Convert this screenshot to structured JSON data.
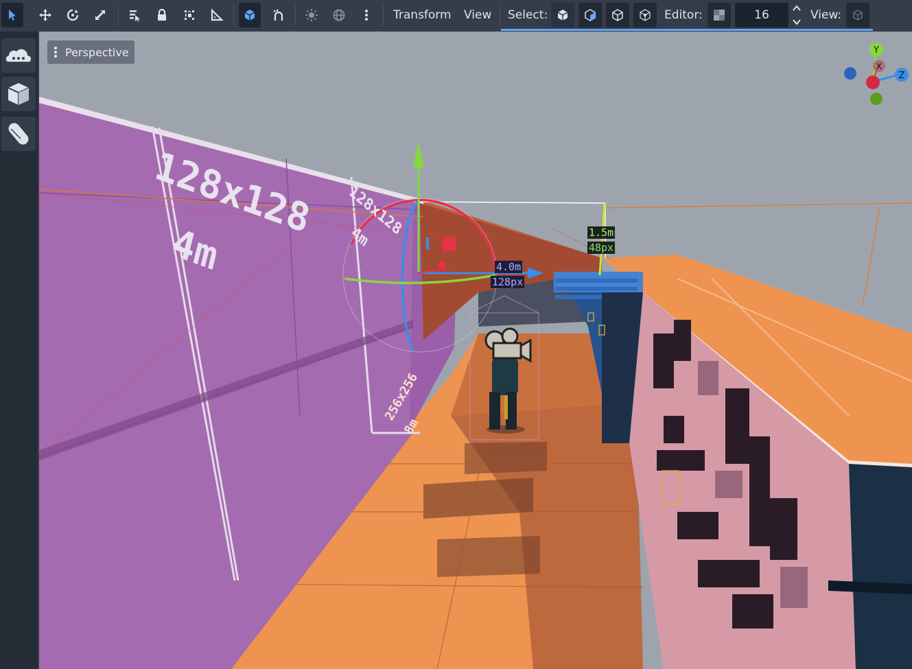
{
  "toolbar": {
    "menus": {
      "transform": "Transform",
      "view": "View"
    },
    "select_label": "Select:",
    "editor_label": "Editor:",
    "snap_value": "16",
    "view_label": "View:"
  },
  "viewport": {
    "perspective_label": "Perspective",
    "gizmo_axes": {
      "y": "Y",
      "x": "X",
      "z": "Z"
    },
    "dimension_a": {
      "meters": "1.5m",
      "pixels": "48px"
    },
    "dimension_b": {
      "meters": "4.0m",
      "pixels": "128px"
    },
    "wall_labels": {
      "large_size": "128x128",
      "large_meters": "4m",
      "small_size": "128x128",
      "small_meters": "4m",
      "floor_size": "256x256",
      "floor_meters": "8m"
    }
  },
  "colors": {
    "accent": "#5ea6ff",
    "wall_purple": "#a56bb0",
    "floor_orange": "#ee9450",
    "axis_x": "#e8304a",
    "axis_y": "#86d83c",
    "axis_z": "#3a8ee8"
  },
  "icons": {
    "select": "cursor-arrow-icon",
    "move": "move-icon",
    "rotate": "rotate-icon",
    "scale": "scale-icon",
    "list_select": "list-select-icon",
    "lock": "lock-icon",
    "group": "group-icon",
    "ruler": "ruler-icon",
    "local_space": "local-space-cube-icon",
    "snap": "snap-magnet-icon",
    "sun": "sun-icon",
    "environment": "globe-icon",
    "more": "vertical-dots-icon"
  }
}
